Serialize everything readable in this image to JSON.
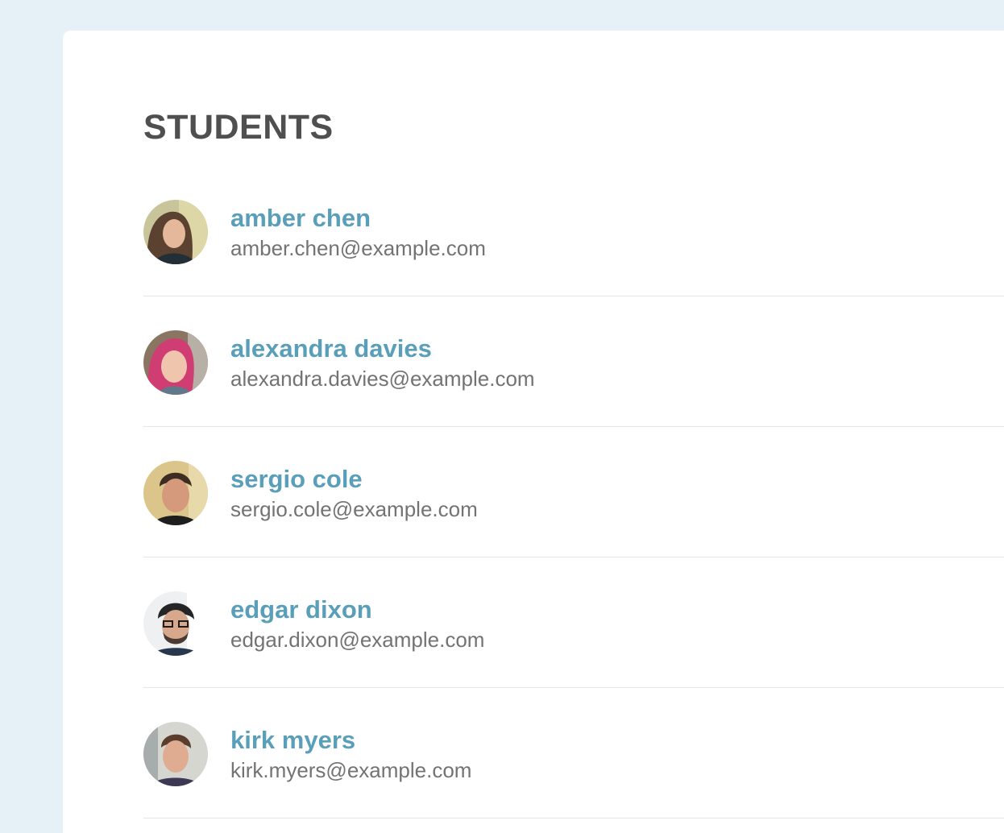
{
  "page": {
    "title": "STUDENTS"
  },
  "students": [
    {
      "name": "amber chen",
      "email": "amber.chen@example.com",
      "avatar_icon": "avatar-photo"
    },
    {
      "name": "alexandra davies",
      "email": "alexandra.davies@example.com",
      "avatar_icon": "avatar-photo"
    },
    {
      "name": "sergio cole",
      "email": "sergio.cole@example.com",
      "avatar_icon": "avatar-photo"
    },
    {
      "name": "edgar dixon",
      "email": "edgar.dixon@example.com",
      "avatar_icon": "avatar-photo"
    },
    {
      "name": "kirk myers",
      "email": "kirk.myers@example.com",
      "avatar_icon": "avatar-photo"
    }
  ],
  "colors": {
    "background": "#e5f1f7",
    "panel": "#ffffff",
    "title": "#4f4f4f",
    "name_link": "#5a9fba",
    "email": "#737373",
    "divider": "#e3e6e8"
  }
}
